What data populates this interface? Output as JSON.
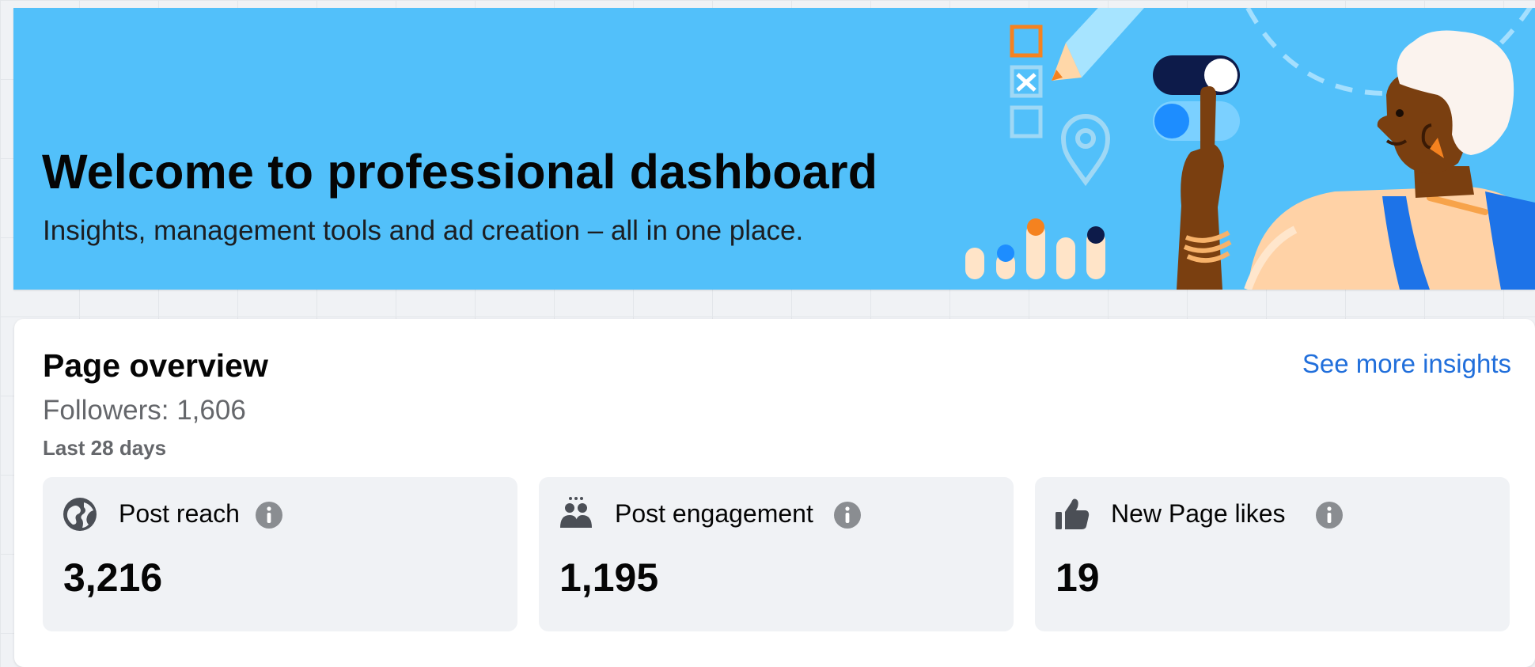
{
  "banner": {
    "title": "Welcome to professional dashboard",
    "subtitle": "Insights, management tools and ad creation – all in one place.",
    "illustration": "person-pointing-at-toggle-illustration"
  },
  "overview": {
    "title": "Page overview",
    "see_more": "See more insights",
    "followers": "Followers: 1,606",
    "period": "Last 28 days",
    "stats": [
      {
        "label": "Post reach",
        "value": "3,216",
        "icon": "globe-icon"
      },
      {
        "label": "Post engagement",
        "value": "1,195",
        "icon": "people-icon"
      },
      {
        "label": "New Page likes",
        "value": "19",
        "icon": "thumbs-up-icon"
      }
    ]
  },
  "colors": {
    "banner_bg": "#52c0fa",
    "link": "#216fdb",
    "card_bg": "#ffffff",
    "stat_bg": "#f0f2f5",
    "secondary_text": "#65676b"
  }
}
